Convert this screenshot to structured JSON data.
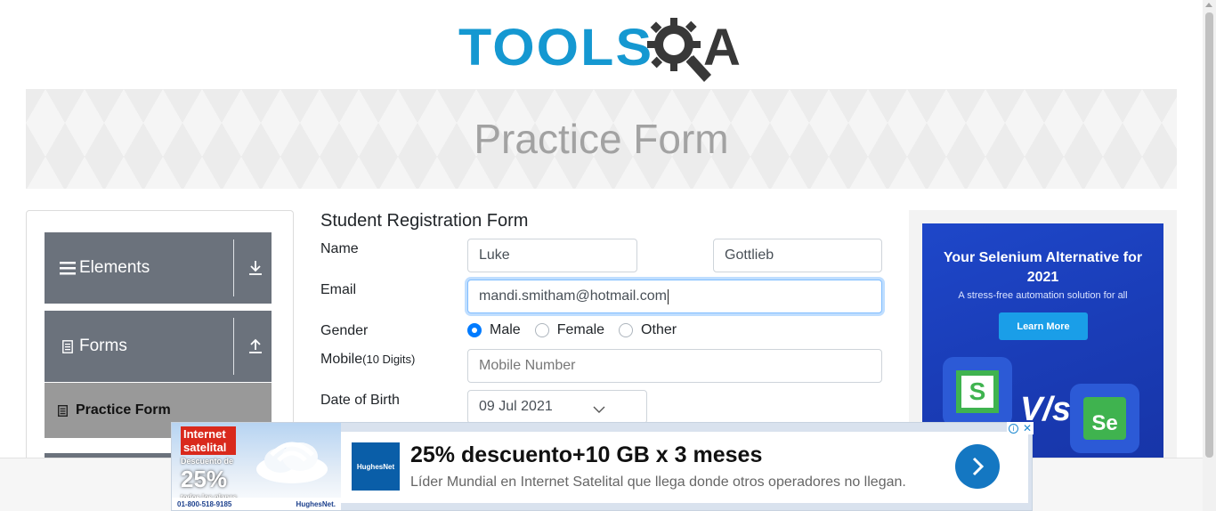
{
  "header": {
    "logo_tools": "TOOLS",
    "logo_a": "A"
  },
  "banner": {
    "title": "Practice Form"
  },
  "sidebar": {
    "groups": [
      {
        "label": "Elements",
        "icon": "hamburger-icon",
        "arrow": "download-arrow-icon"
      },
      {
        "label": "Forms",
        "icon": "document-icon",
        "arrow": "upload-arrow-icon"
      }
    ],
    "active_item": {
      "label": "Practice Form",
      "icon": "document-icon"
    }
  },
  "form": {
    "title": "Student Registration Form",
    "name_label": "Name",
    "first_name": "Luke",
    "last_name": "Gottlieb",
    "email_label": "Email",
    "email_value": "mandi.smitham@hotmail.com",
    "gender_label": "Gender",
    "gender_options": [
      "Male",
      "Female",
      "Other"
    ],
    "gender_selected": "Male",
    "mobile_label": "Mobile",
    "mobile_hint": "(10 Digits)",
    "mobile_placeholder": "Mobile Number",
    "dob_label": "Date of Birth",
    "dob_value": "09 Jul 2021"
  },
  "side_ad": {
    "headline": "Your Selenium Alternative for 2021",
    "subtitle": "A stress-free automation solution for all",
    "button": "Learn More",
    "vs_text": "V/s",
    "colors": {
      "bg": "#1e47c9",
      "button": "#1a9ee8"
    }
  },
  "bottom_ad": {
    "promo_title": "Internet satelital",
    "promo_discount_prefix": "Descuento de",
    "promo_discount": "25%",
    "promo_discount_suffix": "todos los planes",
    "phone": "01-800-518-9185",
    "brand": "HughesNet.",
    "logo_text": "HughesNet",
    "headline": "25% descuento+10 GB x 3 meses",
    "subtext": "Líder Mundial en Internet Satelital que llega donde otros operadores no llegan."
  },
  "colors": {
    "brand_blue": "#1598d1",
    "sidebar_gray": "#6b727c",
    "focus_blue": "#80bdff",
    "radio_blue": "#007bff"
  }
}
